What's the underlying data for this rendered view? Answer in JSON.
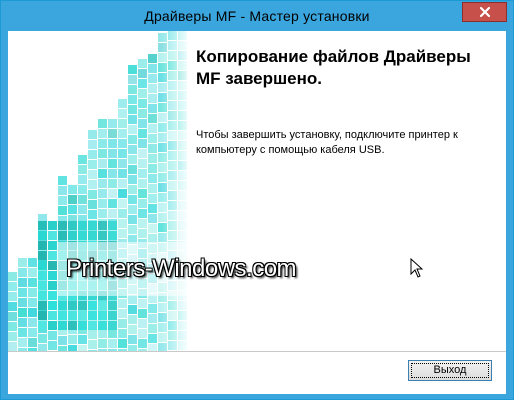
{
  "window": {
    "title": "Драйверы MF - Мастер установки"
  },
  "content": {
    "heading_line1": "Копирование файлов Драйверы",
    "heading_line2": "MF завершено.",
    "message_line1": "Чтобы завершить установку, подключите принтер к",
    "message_line2": "компьютеру с помощью кабеля USB."
  },
  "watermark": {
    "text": "Printers-Windows.com"
  },
  "buttons": {
    "exit_label": "Выход"
  },
  "icons": {
    "close": "close-icon",
    "cursor": "mouse-pointer-icon"
  },
  "colors": {
    "titlebar": "#3aa6dd",
    "close_button": "#c7504a",
    "art_teal": "#2bbcb6"
  }
}
